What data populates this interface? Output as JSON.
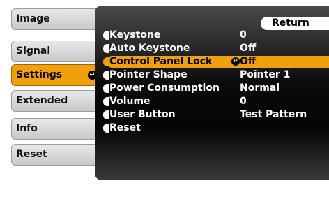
{
  "sidebar": {
    "items": [
      {
        "label": "Image"
      },
      {
        "label": "Signal"
      },
      {
        "label": "Settings"
      },
      {
        "label": "Extended"
      },
      {
        "label": "Info"
      },
      {
        "label": "Reset"
      }
    ],
    "active_enter_icon": "↵"
  },
  "panel": {
    "return_label": "Return",
    "enter_icon": "↵",
    "rows": [
      {
        "label": "Keystone",
        "value": "0"
      },
      {
        "label": "Auto Keystone",
        "value": "Off"
      },
      {
        "label": "Control Panel Lock",
        "value": "Off"
      },
      {
        "label": "Pointer Shape",
        "value": "Pointer 1"
      },
      {
        "label": "Power Consumption",
        "value": "Normal"
      },
      {
        "label": "Volume",
        "value": "0"
      },
      {
        "label": "User Button",
        "value": "Test Pattern"
      },
      {
        "label": "Reset",
        "value": ""
      }
    ]
  },
  "colors": {
    "accent": "#f0a00a",
    "panel_bg": "#050505",
    "sidebar_bg": "#d8d8d8"
  }
}
